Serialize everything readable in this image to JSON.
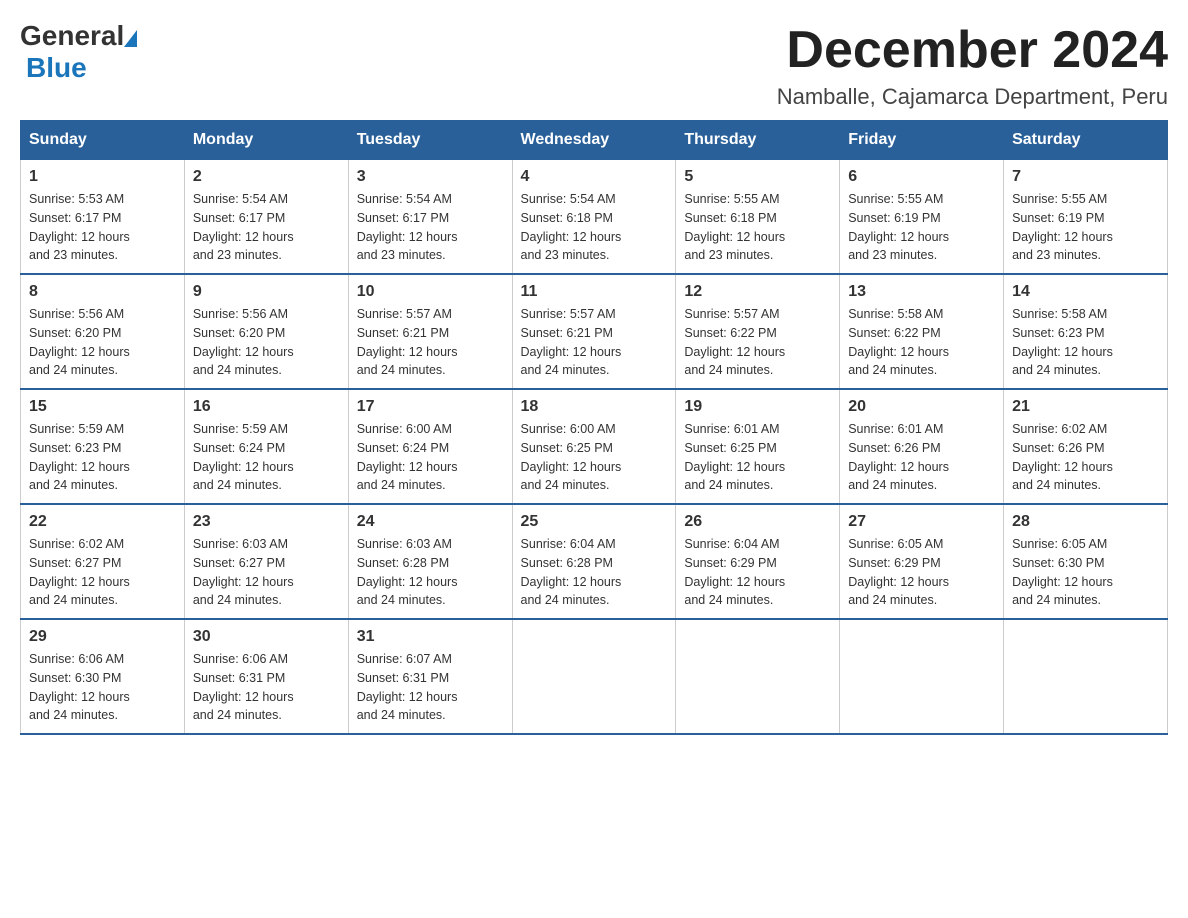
{
  "logo": {
    "general_text": "General",
    "blue_text": "Blue"
  },
  "title": {
    "month_year": "December 2024",
    "location": "Namballe, Cajamarca Department, Peru"
  },
  "days_of_week": [
    "Sunday",
    "Monday",
    "Tuesday",
    "Wednesday",
    "Thursday",
    "Friday",
    "Saturday"
  ],
  "weeks": [
    [
      {
        "day": "1",
        "sunrise": "5:53 AM",
        "sunset": "6:17 PM",
        "daylight": "12 hours and 23 minutes."
      },
      {
        "day": "2",
        "sunrise": "5:54 AM",
        "sunset": "6:17 PM",
        "daylight": "12 hours and 23 minutes."
      },
      {
        "day": "3",
        "sunrise": "5:54 AM",
        "sunset": "6:17 PM",
        "daylight": "12 hours and 23 minutes."
      },
      {
        "day": "4",
        "sunrise": "5:54 AM",
        "sunset": "6:18 PM",
        "daylight": "12 hours and 23 minutes."
      },
      {
        "day": "5",
        "sunrise": "5:55 AM",
        "sunset": "6:18 PM",
        "daylight": "12 hours and 23 minutes."
      },
      {
        "day": "6",
        "sunrise": "5:55 AM",
        "sunset": "6:19 PM",
        "daylight": "12 hours and 23 minutes."
      },
      {
        "day": "7",
        "sunrise": "5:55 AM",
        "sunset": "6:19 PM",
        "daylight": "12 hours and 23 minutes."
      }
    ],
    [
      {
        "day": "8",
        "sunrise": "5:56 AM",
        "sunset": "6:20 PM",
        "daylight": "12 hours and 24 minutes."
      },
      {
        "day": "9",
        "sunrise": "5:56 AM",
        "sunset": "6:20 PM",
        "daylight": "12 hours and 24 minutes."
      },
      {
        "day": "10",
        "sunrise": "5:57 AM",
        "sunset": "6:21 PM",
        "daylight": "12 hours and 24 minutes."
      },
      {
        "day": "11",
        "sunrise": "5:57 AM",
        "sunset": "6:21 PM",
        "daylight": "12 hours and 24 minutes."
      },
      {
        "day": "12",
        "sunrise": "5:57 AM",
        "sunset": "6:22 PM",
        "daylight": "12 hours and 24 minutes."
      },
      {
        "day": "13",
        "sunrise": "5:58 AM",
        "sunset": "6:22 PM",
        "daylight": "12 hours and 24 minutes."
      },
      {
        "day": "14",
        "sunrise": "5:58 AM",
        "sunset": "6:23 PM",
        "daylight": "12 hours and 24 minutes."
      }
    ],
    [
      {
        "day": "15",
        "sunrise": "5:59 AM",
        "sunset": "6:23 PM",
        "daylight": "12 hours and 24 minutes."
      },
      {
        "day": "16",
        "sunrise": "5:59 AM",
        "sunset": "6:24 PM",
        "daylight": "12 hours and 24 minutes."
      },
      {
        "day": "17",
        "sunrise": "6:00 AM",
        "sunset": "6:24 PM",
        "daylight": "12 hours and 24 minutes."
      },
      {
        "day": "18",
        "sunrise": "6:00 AM",
        "sunset": "6:25 PM",
        "daylight": "12 hours and 24 minutes."
      },
      {
        "day": "19",
        "sunrise": "6:01 AM",
        "sunset": "6:25 PM",
        "daylight": "12 hours and 24 minutes."
      },
      {
        "day": "20",
        "sunrise": "6:01 AM",
        "sunset": "6:26 PM",
        "daylight": "12 hours and 24 minutes."
      },
      {
        "day": "21",
        "sunrise": "6:02 AM",
        "sunset": "6:26 PM",
        "daylight": "12 hours and 24 minutes."
      }
    ],
    [
      {
        "day": "22",
        "sunrise": "6:02 AM",
        "sunset": "6:27 PM",
        "daylight": "12 hours and 24 minutes."
      },
      {
        "day": "23",
        "sunrise": "6:03 AM",
        "sunset": "6:27 PM",
        "daylight": "12 hours and 24 minutes."
      },
      {
        "day": "24",
        "sunrise": "6:03 AM",
        "sunset": "6:28 PM",
        "daylight": "12 hours and 24 minutes."
      },
      {
        "day": "25",
        "sunrise": "6:04 AM",
        "sunset": "6:28 PM",
        "daylight": "12 hours and 24 minutes."
      },
      {
        "day": "26",
        "sunrise": "6:04 AM",
        "sunset": "6:29 PM",
        "daylight": "12 hours and 24 minutes."
      },
      {
        "day": "27",
        "sunrise": "6:05 AM",
        "sunset": "6:29 PM",
        "daylight": "12 hours and 24 minutes."
      },
      {
        "day": "28",
        "sunrise": "6:05 AM",
        "sunset": "6:30 PM",
        "daylight": "12 hours and 24 minutes."
      }
    ],
    [
      {
        "day": "29",
        "sunrise": "6:06 AM",
        "sunset": "6:30 PM",
        "daylight": "12 hours and 24 minutes."
      },
      {
        "day": "30",
        "sunrise": "6:06 AM",
        "sunset": "6:31 PM",
        "daylight": "12 hours and 24 minutes."
      },
      {
        "day": "31",
        "sunrise": "6:07 AM",
        "sunset": "6:31 PM",
        "daylight": "12 hours and 24 minutes."
      },
      null,
      null,
      null,
      null
    ]
  ],
  "labels": {
    "sunrise": "Sunrise:",
    "sunset": "Sunset:",
    "daylight": "Daylight:"
  }
}
